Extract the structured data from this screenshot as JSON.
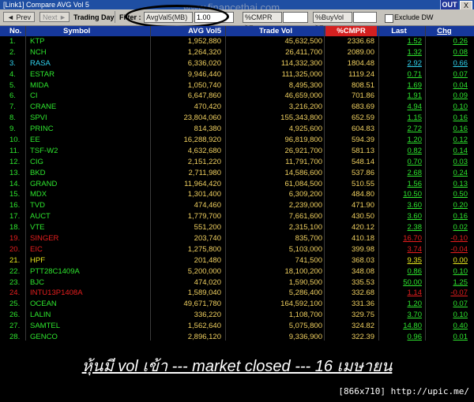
{
  "window": {
    "title": "[Link1] Compare AVG Vol 5",
    "out_label": "OUT",
    "close_label": "X",
    "watermark": "www.financethai.com"
  },
  "toolbar": {
    "prev": "◄ Prev",
    "next": "Next ►",
    "trading_day": "Trading Day",
    "filter_label": "Filter :",
    "avg_filter": "AvgVal5(MB) >=",
    "avg_value": "1.00",
    "cmpr_filter": "%CMPR >=",
    "buyvol_filter": "%BuyVol >=",
    "exclude_dw": "Exclude DW"
  },
  "table": {
    "headers": [
      "No.",
      "Symbol",
      "AVG Vol5",
      "Trade Vol",
      "%CMPR",
      "Last",
      "Chg"
    ],
    "rows": [
      {
        "no": "1.",
        "sym": "KTP",
        "avg": "1,952,880",
        "trade": "45,632,500",
        "cmpr": "2336.68",
        "last": "1.52",
        "chg": "0.26",
        "color": "#2ee62e"
      },
      {
        "no": "2.",
        "sym": "NCH",
        "avg": "1,264,320",
        "trade": "26,411,700",
        "cmpr": "2089.00",
        "last": "1.32",
        "chg": "0.08",
        "color": "#2ee62e"
      },
      {
        "no": "3.",
        "sym": "RASA",
        "avg": "6,336,020",
        "trade": "114,332,300",
        "cmpr": "1804.48",
        "last": "2.92",
        "chg": "0.66",
        "color": "#2fd3f0"
      },
      {
        "no": "4.",
        "sym": "ESTAR",
        "avg": "9,946,440",
        "trade": "111,325,000",
        "cmpr": "1119.24",
        "last": "0.71",
        "chg": "0.07",
        "color": "#2ee62e"
      },
      {
        "no": "5.",
        "sym": "MIDA",
        "avg": "1,050,740",
        "trade": "8,495,300",
        "cmpr": "808.51",
        "last": "1.69",
        "chg": "0.04",
        "color": "#2ee62e"
      },
      {
        "no": "6.",
        "sym": "CI",
        "avg": "6,647,860",
        "trade": "46,659,000",
        "cmpr": "701.86",
        "last": "1.91",
        "chg": "0.09",
        "color": "#2ee62e"
      },
      {
        "no": "7.",
        "sym": "CRANE",
        "avg": "470,420",
        "trade": "3,216,200",
        "cmpr": "683.69",
        "last": "4.94",
        "chg": "0.10",
        "color": "#2ee62e"
      },
      {
        "no": "8.",
        "sym": "SPVI",
        "avg": "23,804,060",
        "trade": "155,343,800",
        "cmpr": "652.59",
        "last": "1.15",
        "chg": "0.16",
        "color": "#2ee62e"
      },
      {
        "no": "9.",
        "sym": "PRINC",
        "avg": "814,380",
        "trade": "4,925,600",
        "cmpr": "604.83",
        "last": "2.72",
        "chg": "0.16",
        "color": "#2ee62e"
      },
      {
        "no": "10.",
        "sym": "EE",
        "avg": "16,288,920",
        "trade": "96,819,800",
        "cmpr": "594.39",
        "last": "1.20",
        "chg": "0.12",
        "color": "#2ee62e"
      },
      {
        "no": "11.",
        "sym": "TSF-W2",
        "avg": "4,632,680",
        "trade": "26,921,700",
        "cmpr": "581.13",
        "last": "0.82",
        "chg": "0.14",
        "color": "#2ee62e"
      },
      {
        "no": "12.",
        "sym": "CIG",
        "avg": "2,151,220",
        "trade": "11,791,700",
        "cmpr": "548.14",
        "last": "0.70",
        "chg": "0.03",
        "color": "#2ee62e"
      },
      {
        "no": "13.",
        "sym": "BKD",
        "avg": "2,711,980",
        "trade": "14,586,600",
        "cmpr": "537.86",
        "last": "2.68",
        "chg": "0.24",
        "color": "#2ee62e"
      },
      {
        "no": "14.",
        "sym": "GRAND",
        "avg": "11,964,420",
        "trade": "61,084,500",
        "cmpr": "510.55",
        "last": "1.56",
        "chg": "0.13",
        "color": "#2ee62e"
      },
      {
        "no": "15.",
        "sym": "MDX",
        "avg": "1,301,400",
        "trade": "6,309,200",
        "cmpr": "484.80",
        "last": "10.50",
        "chg": "0.50",
        "color": "#2ee62e"
      },
      {
        "no": "16.",
        "sym": "TVD",
        "avg": "474,460",
        "trade": "2,239,000",
        "cmpr": "471.90",
        "last": "3.60",
        "chg": "0.20",
        "color": "#2ee62e"
      },
      {
        "no": "17.",
        "sym": "AUCT",
        "avg": "1,779,700",
        "trade": "7,661,600",
        "cmpr": "430.50",
        "last": "3.60",
        "chg": "0.16",
        "color": "#2ee62e"
      },
      {
        "no": "18.",
        "sym": "VTE",
        "avg": "551,200",
        "trade": "2,315,100",
        "cmpr": "420.12",
        "last": "2.38",
        "chg": "0.02",
        "color": "#2ee62e"
      },
      {
        "no": "19.",
        "sym": "SINGER",
        "avg": "203,740",
        "trade": "835,700",
        "cmpr": "410.18",
        "last": "16.70",
        "chg": "-0.10",
        "color": "#e81e1e"
      },
      {
        "no": "20.",
        "sym": "EIC",
        "avg": "1,275,800",
        "trade": "5,103,000",
        "cmpr": "399.98",
        "last": "3.74",
        "chg": "-0.04",
        "color": "#e81e1e"
      },
      {
        "no": "21.",
        "sym": "HPF",
        "avg": "201,480",
        "trade": "741,500",
        "cmpr": "368.03",
        "last": "9.35",
        "chg": "0.00",
        "color": "#e8e81e"
      },
      {
        "no": "22.",
        "sym": "PTT28C1409A",
        "avg": "5,200,000",
        "trade": "18,100,200",
        "cmpr": "348.08",
        "last": "0.86",
        "chg": "0.10",
        "color": "#2ee62e"
      },
      {
        "no": "23.",
        "sym": "BJC",
        "avg": "474,020",
        "trade": "1,590,500",
        "cmpr": "335.53",
        "last": "50.00",
        "chg": "1.25",
        "color": "#2ee62e"
      },
      {
        "no": "24.",
        "sym": "INTU13P1408A",
        "avg": "1,589,040",
        "trade": "5,286,400",
        "cmpr": "332.68",
        "last": "1.14",
        "chg": "-0.07",
        "color": "#e81e1e"
      },
      {
        "no": "25.",
        "sym": "OCEAN",
        "avg": "49,671,780",
        "trade": "164,592,100",
        "cmpr": "331.36",
        "last": "1.20",
        "chg": "0.07",
        "color": "#2ee62e"
      },
      {
        "no": "26.",
        "sym": "LALIN",
        "avg": "336,220",
        "trade": "1,108,700",
        "cmpr": "329.75",
        "last": "3.70",
        "chg": "0.10",
        "color": "#2ee62e"
      },
      {
        "no": "27.",
        "sym": "SAMTEL",
        "avg": "1,562,640",
        "trade": "5,075,800",
        "cmpr": "324.82",
        "last": "14.80",
        "chg": "0.40",
        "color": "#2ee62e"
      },
      {
        "no": "28.",
        "sym": "GENCO",
        "avg": "2,896,120",
        "trade": "9,336,900",
        "cmpr": "322.39",
        "last": "0.96",
        "chg": "0.01",
        "color": "#2ee62e"
      }
    ]
  },
  "caption": "หุ้นมี vol เข้า --- market closed --- 16 เมษายน",
  "credit": "[866x710] http://upic.me/"
}
